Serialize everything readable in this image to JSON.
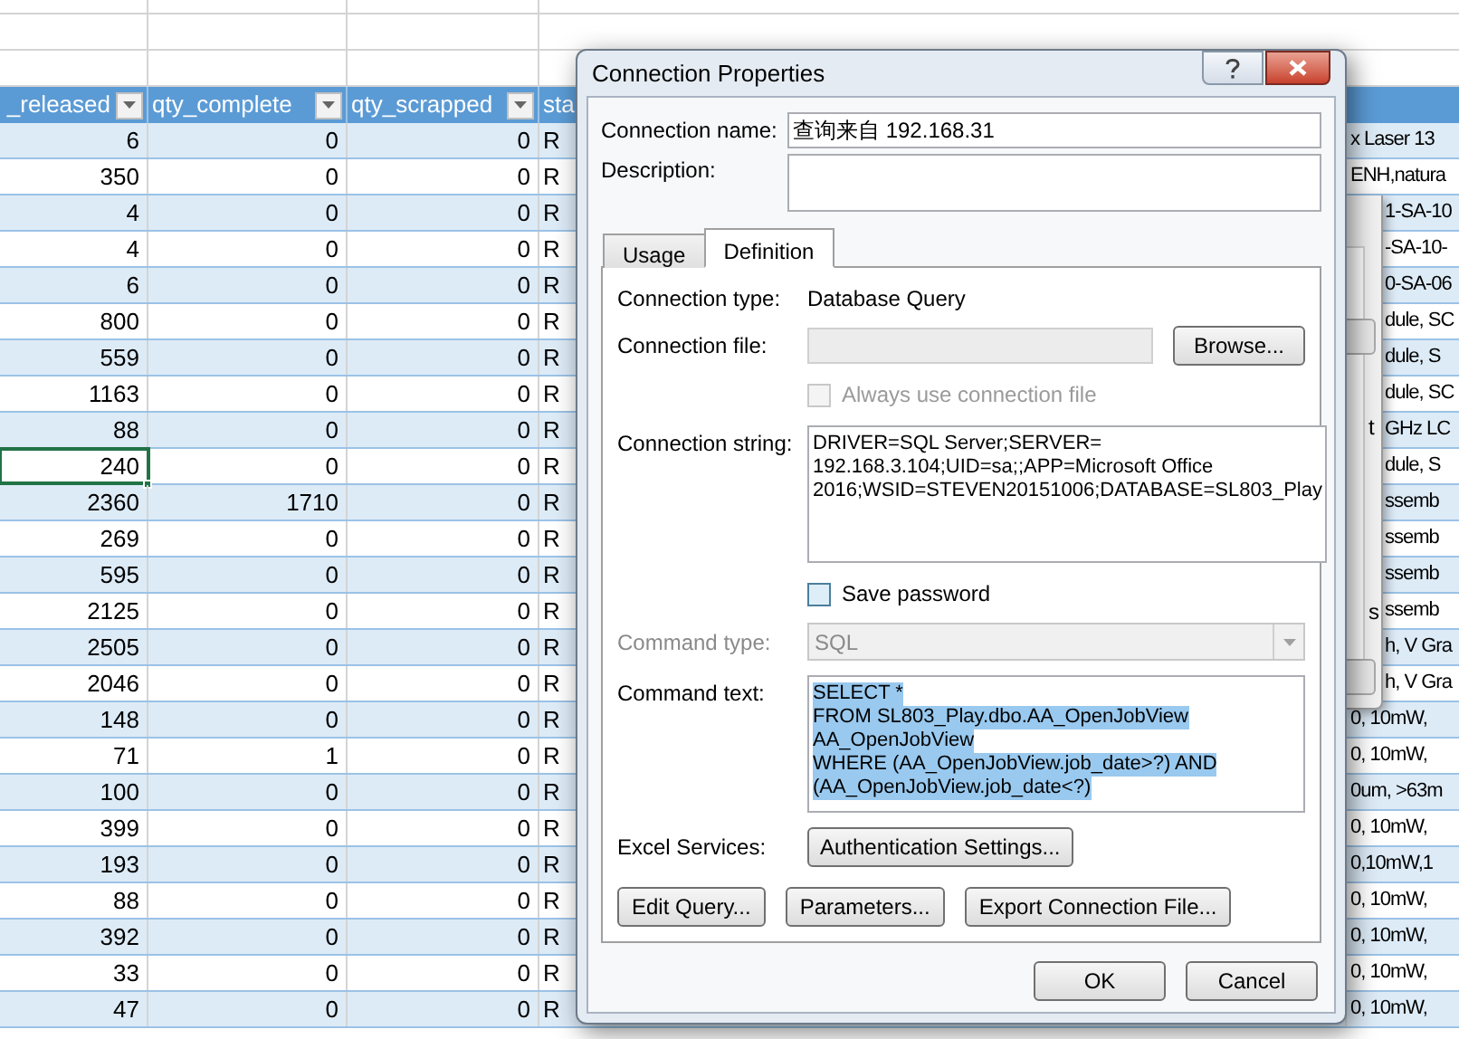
{
  "spreadsheet": {
    "columns": [
      {
        "label": "_released",
        "filter": true
      },
      {
        "label": "qty_complete",
        "filter": true
      },
      {
        "label": "qty_scrapped",
        "filter": true
      },
      {
        "label": "sta",
        "filter": false
      }
    ],
    "rows": [
      {
        "cells": [
          "6",
          "0",
          "0",
          "R"
        ],
        "column_5": "x Laser 13",
        "selected": false
      },
      {
        "cells": [
          "350",
          "0",
          "0",
          "R"
        ],
        "column_5": "ENH,natura",
        "selected": false
      },
      {
        "cells": [
          "4",
          "0",
          "0",
          "R"
        ],
        "column_5": "1-SA-10",
        "selected": false
      },
      {
        "cells": [
          "4",
          "0",
          "0",
          "R"
        ],
        "column_5": "-SA-10-",
        "selected": false
      },
      {
        "cells": [
          "6",
          "0",
          "0",
          "R"
        ],
        "column_5": "0-SA-06",
        "selected": false
      },
      {
        "cells": [
          "800",
          "0",
          "0",
          "R"
        ],
        "column_5": "dule, SC",
        "selected": false
      },
      {
        "cells": [
          "559",
          "0",
          "0",
          "R"
        ],
        "column_5": "dule, S",
        "selected": false
      },
      {
        "cells": [
          "1163",
          "0",
          "0",
          "R"
        ],
        "column_5": "dule, SC",
        "selected": false
      },
      {
        "cells": [
          "88",
          "0",
          "0",
          "R"
        ],
        "column_5": "GHz LC",
        "selected": false
      },
      {
        "cells": [
          "240",
          "0",
          "0",
          "R"
        ],
        "column_5": "dule, S",
        "selected": true
      },
      {
        "cells": [
          "2360",
          "1710",
          "0",
          "R"
        ],
        "column_5": "ssemb",
        "selected": false
      },
      {
        "cells": [
          "269",
          "0",
          "0",
          "R"
        ],
        "column_5": "ssemb",
        "selected": false
      },
      {
        "cells": [
          "595",
          "0",
          "0",
          "R"
        ],
        "column_5": "ssemb",
        "selected": false
      },
      {
        "cells": [
          "2125",
          "0",
          "0",
          "R"
        ],
        "column_5": "ssemb",
        "selected": false
      },
      {
        "cells": [
          "2505",
          "0",
          "0",
          "R"
        ],
        "column_5": "h, V Gra",
        "selected": false
      },
      {
        "cells": [
          "2046",
          "0",
          "0",
          "R"
        ],
        "column_5": "h, V Gra",
        "selected": false
      },
      {
        "cells": [
          "148",
          "0",
          "0",
          "R"
        ],
        "column_5": "0, 10mW,",
        "selected": false
      },
      {
        "cells": [
          "71",
          "1",
          "0",
          "R"
        ],
        "column_5": "0, 10mW,",
        "selected": false
      },
      {
        "cells": [
          "100",
          "0",
          "0",
          "R"
        ],
        "column_5": "0um, >63m",
        "selected": false
      },
      {
        "cells": [
          "399",
          "0",
          "0",
          "R"
        ],
        "column_5": "0, 10mW,",
        "selected": false
      },
      {
        "cells": [
          "193",
          "0",
          "0",
          "R"
        ],
        "column_5": "0,10mW,1",
        "selected": false
      },
      {
        "cells": [
          "88",
          "0",
          "0",
          "R"
        ],
        "column_5": "0, 10mW,",
        "selected": false
      },
      {
        "cells": [
          "392",
          "0",
          "0",
          "R"
        ],
        "column_5": "0, 10mW,",
        "selected": false
      },
      {
        "cells": [
          "33",
          "0",
          "0",
          "R"
        ],
        "column_5": "0, 10mW,",
        "selected": false
      },
      {
        "cells": [
          "47",
          "0",
          "0",
          "R"
        ],
        "column_5": "0, 10mW,",
        "selected": false
      }
    ]
  },
  "background_dialog": {
    "texts": [
      "t",
      "s"
    ]
  },
  "dialog": {
    "title": "Connection Properties",
    "connection_name": {
      "label": "Connection name:",
      "value": "查询来自 192.168.31"
    },
    "description": {
      "label": "Description:"
    },
    "tabs": [
      {
        "label": "Usage",
        "selected": false
      },
      {
        "label": "Definition",
        "selected": true
      }
    ],
    "connection_type": {
      "label": "Connection type:",
      "value": "Database Query"
    },
    "connection_file": {
      "label": "Connection file:",
      "disabled": true
    },
    "browse_button": "Browse...",
    "always_use_file": {
      "label": "Always use connection file",
      "checked": false,
      "disabled": true
    },
    "connection_string": {
      "label": "Connection string:",
      "lines": [
        "DRIVER=SQL Server;SERVER=",
        "192.168.3.104;UID=sa;;APP=Microsoft Office",
        "2016;WSID=STEVEN20151006;DATABASE=SL803_Play"
      ]
    },
    "save_password": {
      "label": "Save password",
      "checked": false,
      "disabled": false
    },
    "command_type": {
      "label": "Command type:",
      "value": "SQL",
      "disabled": true
    },
    "command_text": {
      "label": "Command text:",
      "selected": true,
      "lines": [
        "SELECT *",
        "FROM SL803_Play.dbo.AA_OpenJobView",
        "AA_OpenJobView",
        "WHERE (AA_OpenJobView.job_date>?) AND",
        "(AA_OpenJobView.job_date<?)"
      ]
    },
    "excel_services": {
      "label": "Excel Services:",
      "button": "Authentication Settings..."
    },
    "action_buttons": [
      "Edit Query...",
      "Parameters...",
      "Export Connection File..."
    ],
    "footer_buttons": [
      "OK",
      "Cancel"
    ]
  }
}
